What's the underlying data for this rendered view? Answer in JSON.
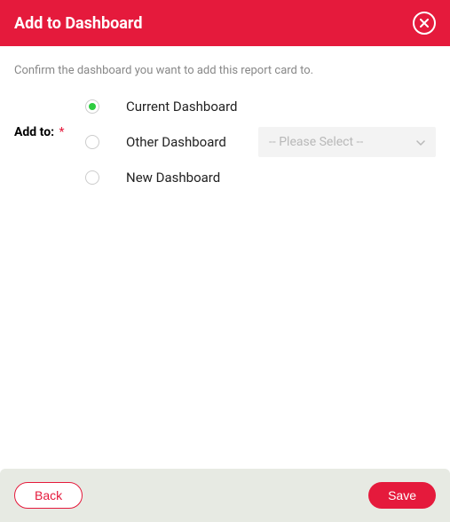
{
  "header": {
    "title": "Add to Dashboard"
  },
  "instruction": "Confirm the dashboard you want to add this report card to.",
  "form": {
    "label": "Add to:",
    "required_mark": "*",
    "options": [
      {
        "label": "Current Dashboard"
      },
      {
        "label": "Other Dashboard"
      },
      {
        "label": "New Dashboard"
      }
    ],
    "select_placeholder": "-- Please Select --"
  },
  "footer": {
    "back": "Back",
    "save": "Save"
  },
  "colors": {
    "brand": "#e51a3c",
    "radio_selected": "#2ecc40",
    "footer_bg": "#e7eae3"
  }
}
